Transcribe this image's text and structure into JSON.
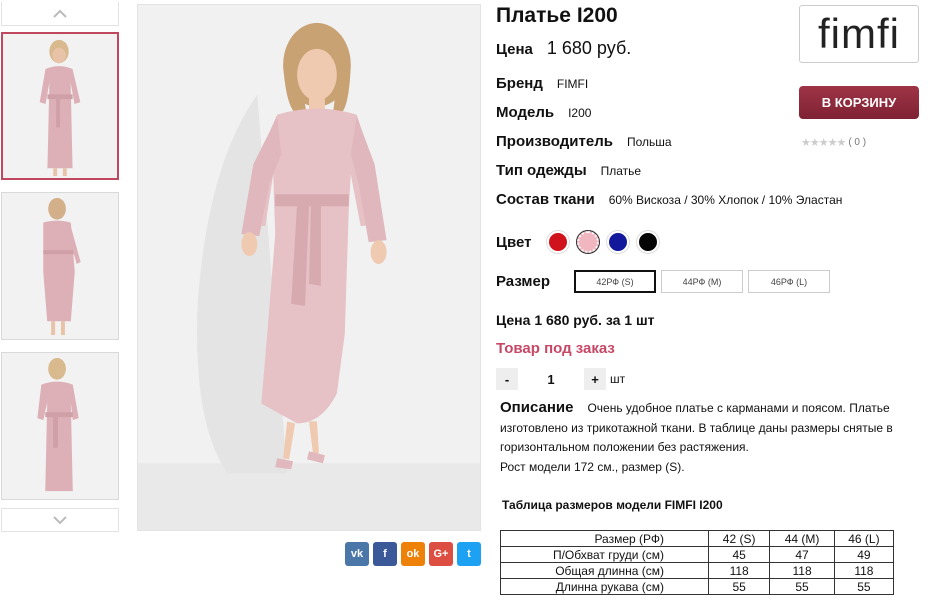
{
  "product": {
    "title": "Платье I200",
    "price_label": "Цена",
    "price_value": "1 680 руб."
  },
  "attributes": [
    {
      "key": "Бренд",
      "value": "FIMFI"
    },
    {
      "key": "Модель",
      "value": "I200"
    },
    {
      "key": "Производитель",
      "value": "Польша"
    },
    {
      "key": "Тип одежды",
      "value": "Платье"
    },
    {
      "key": "Состав ткани",
      "value": "60% Вискоза / 30% Хлопок / 10% Эластан"
    }
  ],
  "logo_text": "fimfi",
  "cart_button": "В КОРЗИНУ",
  "rating": {
    "count": "( 0 )",
    "stars": "★★★★★"
  },
  "color": {
    "label": "Цвет",
    "swatches": [
      "#d0121d",
      "#f1b7c1",
      "#12179b",
      "#050505"
    ]
  },
  "size": {
    "label": "Размер",
    "options": [
      "42РФ (S)",
      "44РФ (M)",
      "46РФ (L)"
    ],
    "selected": "42РФ (S)"
  },
  "total_text": "Цена 1 680 руб. за 1 шт",
  "order_status": "Товар под заказ",
  "quantity": {
    "minus": "-",
    "value": "1",
    "plus": "+",
    "unit": "шт"
  },
  "description": {
    "title": "Описание",
    "text": "Очень удобное платье с карманами и поясом. Платье изготовлено из трикотажной ткани. В таблице даны размеры снятые в горизонтальном положении без растяжения.",
    "model_info": "Рост модели 172 см., размер (S)."
  },
  "size_table": {
    "title": "Таблица размеров модели FIMFI I200",
    "header": [
      "Размер (РФ)",
      "42 (S)",
      "44 (M)",
      "46 (L)"
    ],
    "rows": [
      [
        "П/Обхват груди (см)",
        "45",
        "47",
        "49"
      ],
      [
        "Общая длинна (см)",
        "118",
        "118",
        "118"
      ],
      [
        "Длинна рукава (см)",
        "55",
        "55",
        "55"
      ]
    ]
  },
  "social": [
    {
      "name": "vk",
      "label": "vk",
      "color": "#4a76a8"
    },
    {
      "name": "facebook",
      "label": "f",
      "color": "#3b5998"
    },
    {
      "name": "odnoklassniki",
      "label": "ok",
      "color": "#ee8208"
    },
    {
      "name": "google-plus",
      "label": "G+",
      "color": "#dc4e41"
    },
    {
      "name": "twitter",
      "label": "t",
      "color": "#1da1f2"
    }
  ],
  "colors": {
    "accent": "#8f2b3d",
    "status": "#c64866",
    "active_thumb_border": "#c0485e"
  }
}
